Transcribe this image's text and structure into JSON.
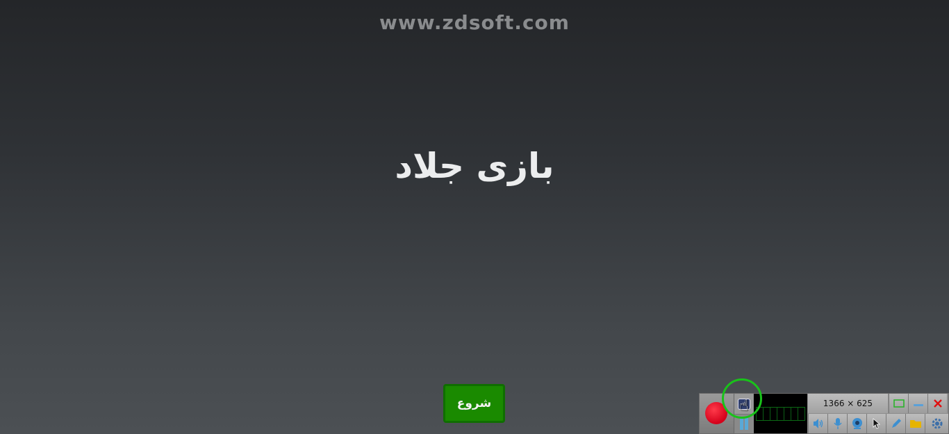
{
  "watermark": {
    "text": "www.zdsoft.com"
  },
  "game": {
    "title": "بازی جلاد",
    "start_label": "شروع"
  },
  "recorder": {
    "dimensions": "1366 × 625",
    "icons": {
      "record": "record-icon",
      "screenshot": "camera-icon",
      "pause": "pause-icon",
      "region": "region-rect-icon",
      "minimize": "minimize-icon",
      "close": "close-icon",
      "speaker": "speaker-icon",
      "microphone": "microphone-icon",
      "webcam": "webcam-icon",
      "cursor": "mouse-cursor-icon",
      "pen": "pen-icon",
      "folder": "folder-icon",
      "settings": "gear-icon"
    }
  },
  "colors": {
    "start_button": "#1a8a00",
    "record": "#d4001a",
    "highlight_ring": "#19c21a"
  }
}
